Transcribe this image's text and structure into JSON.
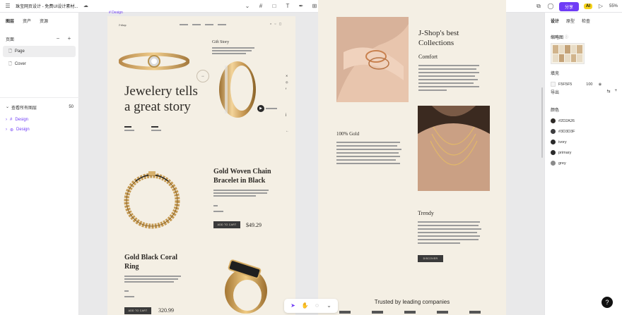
{
  "topbar": {
    "breadcrumb": "珠宝网页设计 - 免费UI设计素材...",
    "share_label": "分享",
    "ai_label": "AI",
    "zoom": "55%"
  },
  "left_panel": {
    "tabs": [
      "图层",
      "资产",
      "资源"
    ],
    "pages_label": "页面",
    "pages": [
      "Page",
      "Cover"
    ],
    "layers_label": "查看所有图层",
    "layers_count": "50",
    "layers": [
      "Design",
      "Design"
    ]
  },
  "right_panel": {
    "tabs": [
      "设计",
      "原型",
      "检查"
    ],
    "thumbnail_label": "缩略图",
    "fill_label": "填充",
    "fill_hex": "F5F5F5",
    "fill_opacity": "100",
    "export_label": "导出",
    "colors_label": "颜色",
    "colors": [
      {
        "name": "#2D2A26",
        "hex": "#2D2A26"
      },
      {
        "name": "#3D3D3F",
        "hex": "#3D3D3F"
      },
      {
        "name": "ivory",
        "hex": "#2a2a2a"
      },
      {
        "name": "primary",
        "hex": "#2a2a2a"
      },
      {
        "name": "grey",
        "hex": "#8a8a8a"
      }
    ]
  },
  "canvas": {
    "frame_label": "Design",
    "hero": {
      "brand": "J-shop",
      "gift_story": "Gift Story",
      "title_line1": "Jewelery tells",
      "title_line2": "a great story"
    },
    "product1": {
      "title_line1": "Gold Woven Chain",
      "title_line2": "Bracelet in Black",
      "button": "ADD TO CART",
      "price": "$49.29"
    },
    "product2": {
      "title_line1": "Gold Black Coral",
      "title_line2": "Ring",
      "button": "ADD TO CART",
      "price": "320.99"
    },
    "collections": {
      "title_line1": "J-Shop's best",
      "title_line2": "Collections",
      "comfort": "Comfort",
      "gold": "100% Gold",
      "trendy": "Trendy",
      "button": "DISCOVER",
      "trusted": "Trusted by leading companies"
    }
  }
}
